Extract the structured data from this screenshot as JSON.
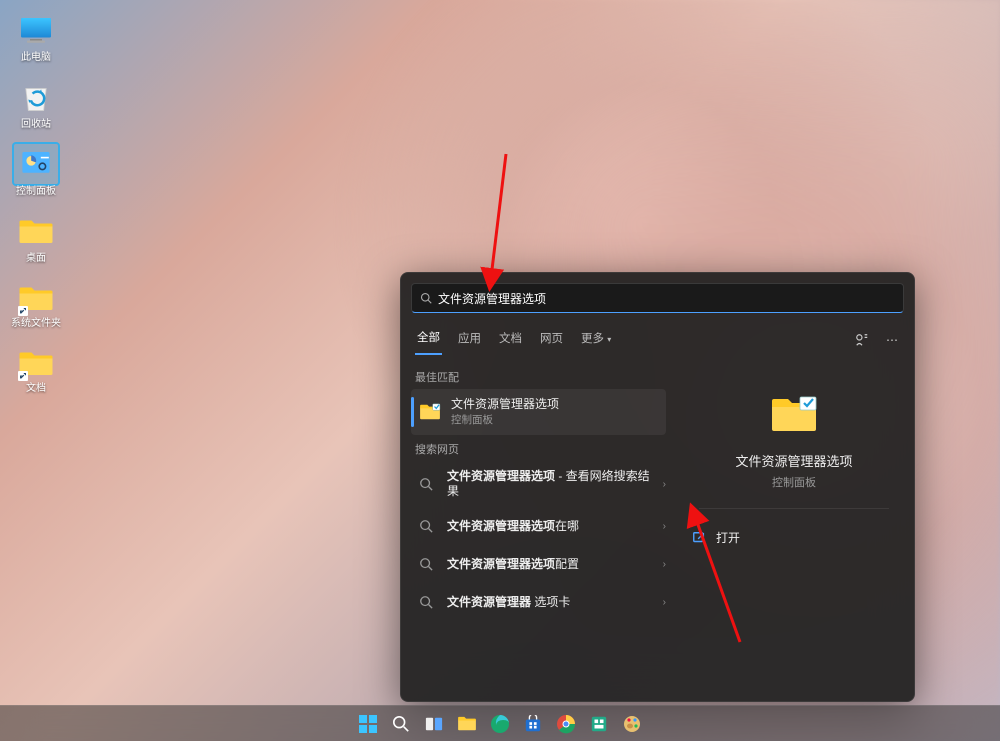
{
  "desktop": {
    "icons": [
      {
        "name": "此电脑",
        "type": "thispc"
      },
      {
        "name": "回收站",
        "type": "recycle"
      },
      {
        "name": "控制面板",
        "type": "controlpanel"
      },
      {
        "name": "桌面",
        "type": "folder"
      },
      {
        "name": "系统文件夹",
        "type": "folder-shortcut"
      },
      {
        "name": "文档",
        "type": "folder-shortcut"
      }
    ]
  },
  "search": {
    "query": "文件资源管理器选项",
    "tabs": {
      "all": "全部",
      "apps": "应用",
      "docs": "文档",
      "web": "网页",
      "more": "更多"
    },
    "sections": {
      "best_match_label": "最佳匹配",
      "web_label": "搜索网页"
    },
    "best_match": {
      "title": "文件资源管理器选项",
      "subtitle": "控制面板"
    },
    "web_results": [
      {
        "prefix": "文件资源管理器选项",
        "suffix": " - 查看网络搜索结果"
      },
      {
        "prefix": "文件资源管理器选项",
        "suffix": "在哪"
      },
      {
        "prefix": "文件资源管理器选项",
        "suffix": "配置"
      },
      {
        "prefix": "文件资源管理器",
        "suffix": " 选项卡"
      }
    ],
    "preview": {
      "title": "文件资源管理器选项",
      "subtitle": "控制面板",
      "action_open": "打开"
    }
  }
}
